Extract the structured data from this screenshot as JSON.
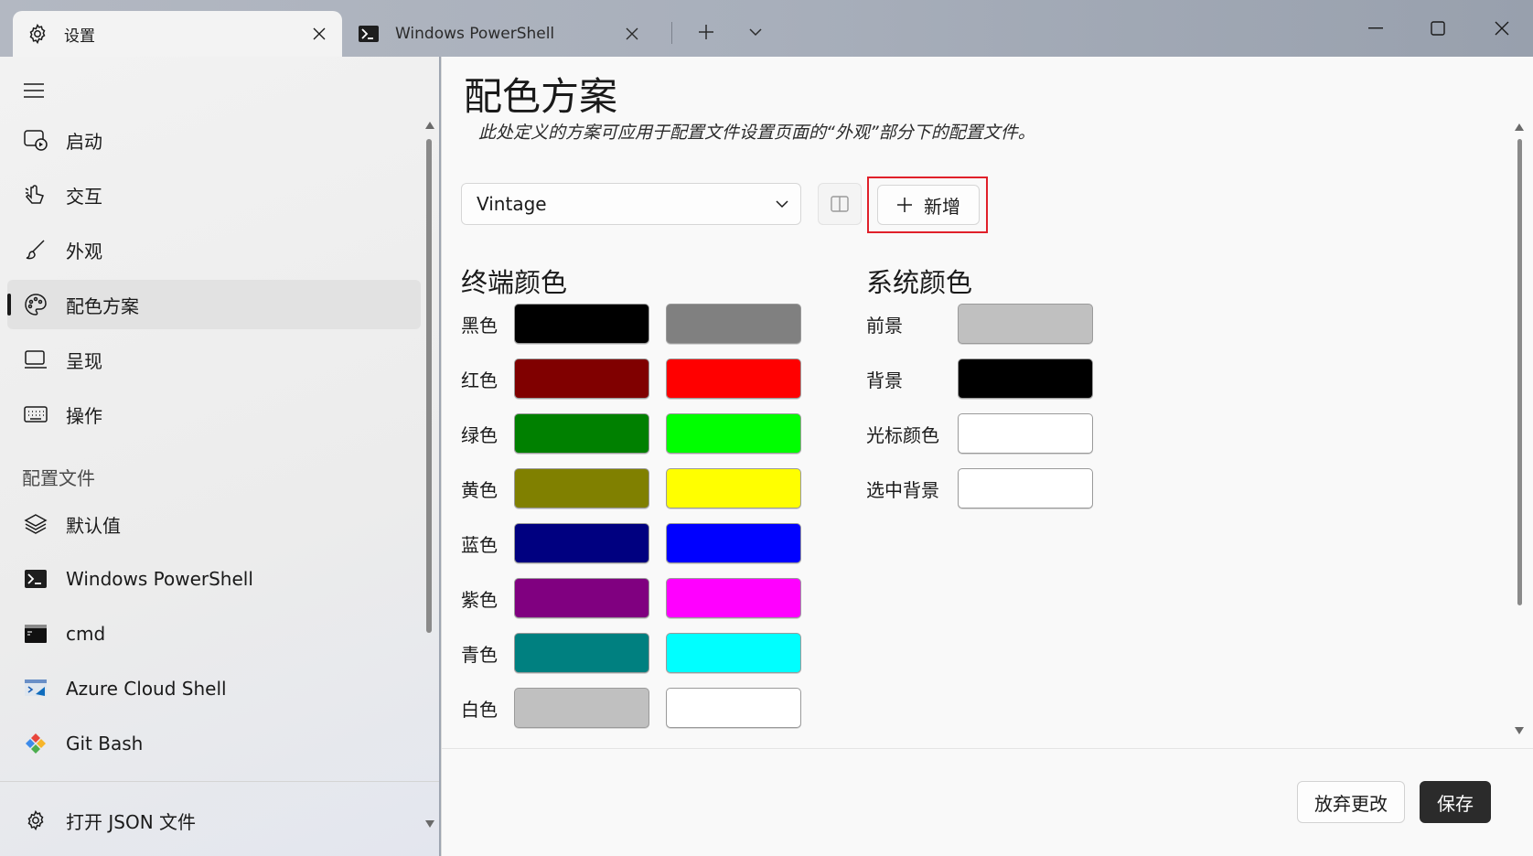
{
  "titlebar": {
    "tabs": [
      {
        "label": "设置",
        "icon": "gear-icon",
        "active": true
      },
      {
        "label": "Windows PowerShell",
        "icon": "powershell-icon",
        "active": false
      }
    ]
  },
  "sidebar": {
    "items": [
      {
        "label": "启动",
        "icon": "startup-icon"
      },
      {
        "label": "交互",
        "icon": "interaction-icon"
      },
      {
        "label": "外观",
        "icon": "brush-icon"
      },
      {
        "label": "配色方案",
        "icon": "palette-icon",
        "selected": true
      },
      {
        "label": "呈现",
        "icon": "monitor-icon"
      },
      {
        "label": "操作",
        "icon": "keyboard-icon"
      }
    ],
    "profiles_section": "配置文件",
    "profiles": [
      {
        "label": "默认值",
        "icon": "layers-icon"
      },
      {
        "label": "Windows PowerShell",
        "icon": "powershell-icon"
      },
      {
        "label": "cmd",
        "icon": "cmd-icon"
      },
      {
        "label": "Azure Cloud Shell",
        "icon": "azure-icon"
      },
      {
        "label": "Git Bash",
        "icon": "git-icon"
      }
    ],
    "footer": {
      "label": "打开 JSON 文件",
      "icon": "gear-icon"
    }
  },
  "main": {
    "title": "配色方案",
    "description": "此处定义的方案可应用于配置文件设置页面的“外观”部分下的配置文件。",
    "scheme_select": {
      "value": "Vintage"
    },
    "add_button": "新增",
    "terminal_colors": {
      "heading": "终端颜色",
      "rows": [
        {
          "label": "黑色",
          "normal": "#000000",
          "bright": "#808080"
        },
        {
          "label": "红色",
          "normal": "#800000",
          "bright": "#ff0000"
        },
        {
          "label": "绿色",
          "normal": "#008000",
          "bright": "#00ff00"
        },
        {
          "label": "黄色",
          "normal": "#808000",
          "bright": "#ffff00"
        },
        {
          "label": "蓝色",
          "normal": "#000080",
          "bright": "#0000ff"
        },
        {
          "label": "紫色",
          "normal": "#800080",
          "bright": "#ff00ff"
        },
        {
          "label": "青色",
          "normal": "#008080",
          "bright": "#00ffff"
        },
        {
          "label": "白色",
          "normal": "#c0c0c0",
          "bright": "#ffffff"
        }
      ]
    },
    "system_colors": {
      "heading": "系统颜色",
      "rows": [
        {
          "label": "前景",
          "color": "#c0c0c0"
        },
        {
          "label": "背景",
          "color": "#000000"
        },
        {
          "label": "光标颜色",
          "color": "#ffffff"
        },
        {
          "label": "选中背景",
          "color": "#ffffff"
        }
      ]
    },
    "discard_button": "放弃更改",
    "save_button": "保存"
  }
}
